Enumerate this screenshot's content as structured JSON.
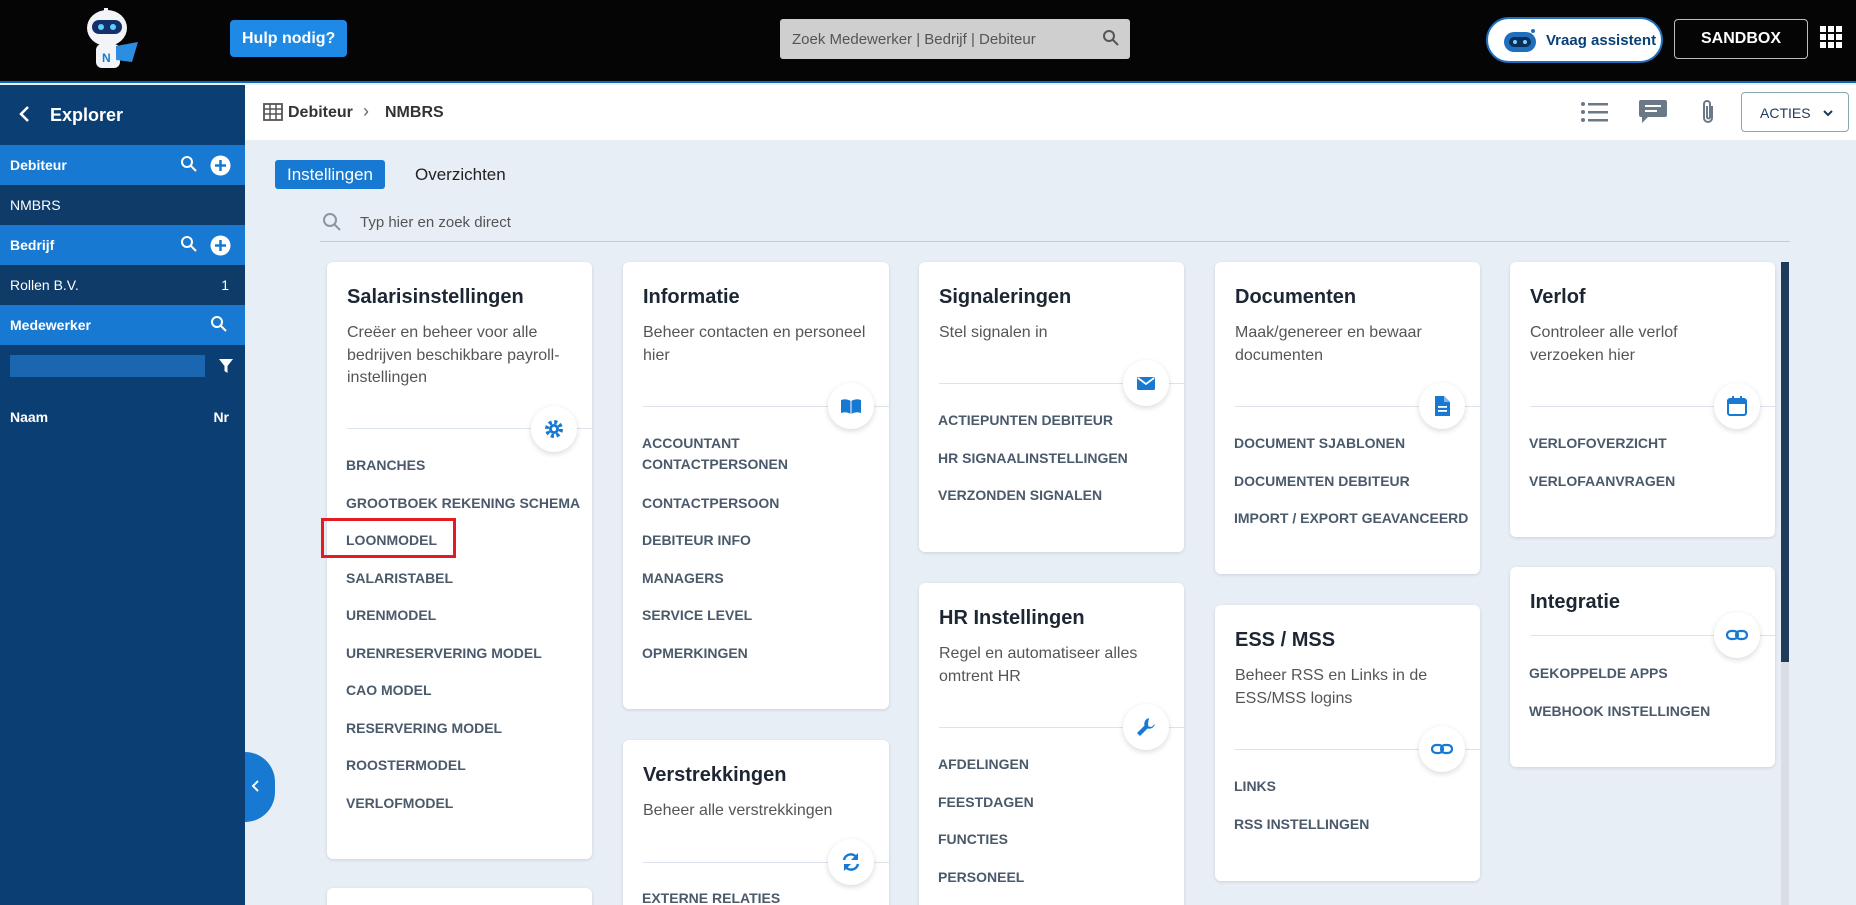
{
  "header": {
    "help_label": "Hulp nodig?",
    "search_placeholder": "Zoek Medewerker |  Bedrijf | Debiteur",
    "assistant_label": "Vraag assistent",
    "sandbox_label": "SANDBOX"
  },
  "sidebar": {
    "title": "Explorer",
    "debiteur_label": "Debiteur",
    "debiteur_value": "NMBRS",
    "bedrijf_label": "Bedrijf",
    "bedrijf_item": "Rollen B.V.",
    "bedrijf_item_count": "1",
    "medewerker_label": "Medewerker",
    "col_name": "Naam",
    "col_nr": "Nr"
  },
  "breadcrumb": {
    "level1": "Debiteur",
    "level2": "NMBRS"
  },
  "actions_label": "ACTIES",
  "tabs": {
    "active": "Instellingen",
    "other": "Overzichten"
  },
  "main_search_placeholder": "Typ hier en zoek direct",
  "cards": {
    "salaris": {
      "title": "Salarisinstellingen",
      "desc": "Creëer en beheer voor alle bedrijven beschikbare payroll-instellingen",
      "links": [
        "BRANCHES",
        "GROOTBOEK REKENING SCHEMA",
        "LOONMODEL",
        "SALARISTABEL",
        "URENMODEL",
        "URENRESERVERING MODEL",
        "CAO MODEL",
        "RESERVERING MODEL",
        "ROOSTERMODEL",
        "VERLOFMODEL"
      ]
    },
    "informatie": {
      "title": "Informatie",
      "desc": "Beheer contacten en personeel hier",
      "links": [
        "ACCOUNTANT CONTACTPERSONEN",
        "CONTACTPERSOON",
        "DEBITEUR INFO",
        "MANAGERS",
        "SERVICE LEVEL",
        "OPMERKINGEN"
      ]
    },
    "verstrekkingen": {
      "title": "Verstrekkingen",
      "desc": "Beheer alle verstrekkingen",
      "links": [
        "EXTERNE RELATIES"
      ]
    },
    "signaleringen": {
      "title": "Signaleringen",
      "desc": "Stel signalen in",
      "links": [
        "ACTIEPUNTEN DEBITEUR",
        "HR SIGNAALINSTELLINGEN",
        "VERZONDEN SIGNALEN"
      ]
    },
    "hr": {
      "title": "HR Instellingen",
      "desc": "Regel en automatiseer alles omtrent HR",
      "links": [
        "AFDELINGEN",
        "FEESTDAGEN",
        "FUNCTIES",
        "PERSONEEL"
      ]
    },
    "documenten": {
      "title": "Documenten",
      "desc": "Maak/genereer en bewaar documenten",
      "links": [
        "DOCUMENT SJABLONEN",
        "DOCUMENTEN DEBITEUR",
        "IMPORT / EXPORT GEAVANCEERD"
      ]
    },
    "ess": {
      "title": "ESS / MSS",
      "desc": "Beheer RSS en Links in de ESS/MSS logins",
      "links": [
        "LINKS",
        "RSS INSTELLINGEN"
      ]
    },
    "verlof": {
      "title": "Verlof",
      "desc": "Controleer alle verlof verzoeken hier",
      "links": [
        "VERLOFOVERZICHT",
        "VERLOFAANVRAGEN"
      ]
    },
    "integratie": {
      "title": "Integratie",
      "links": [
        "GEKOPPELDE APPS",
        "WEBHOOK INSTELLINGEN"
      ]
    }
  }
}
